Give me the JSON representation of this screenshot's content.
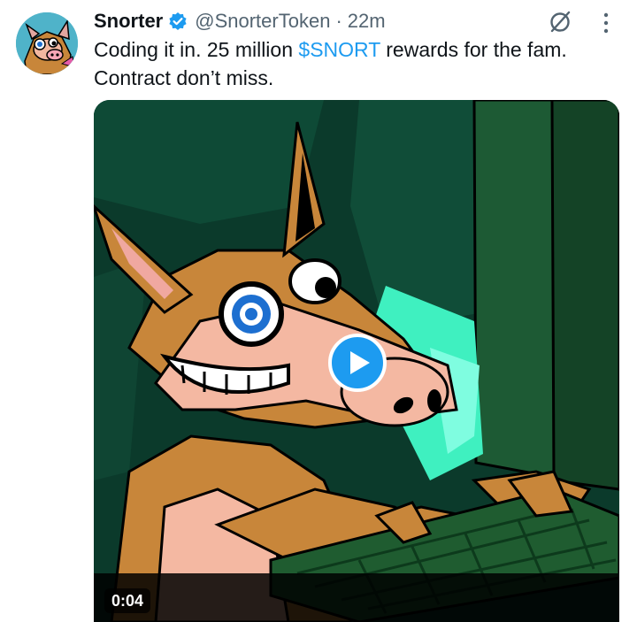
{
  "author": {
    "name": "Snorter",
    "handle": "@SnorterToken",
    "separator": "·",
    "time": "22m",
    "verified": true,
    "avatar_icon": "snorter-avatar"
  },
  "tweet": {
    "text_line1_before": "Coding it in. 25 million ",
    "cashtag": "$SNORT",
    "text_line1_after": " rewards for the fam.",
    "text_line2": "Contract don’t miss."
  },
  "media": {
    "type": "video",
    "duration": "0:04",
    "description_icon": "cartoon-snorter-typing-on-keyboard"
  },
  "icons": {
    "grok": "grok-icon",
    "more": "more-options-icon",
    "play": "play-icon",
    "verified": "verified-badge-icon"
  },
  "colors": {
    "accent": "#1d9bf0",
    "text_primary": "#0f1419",
    "text_secondary": "#536471"
  }
}
